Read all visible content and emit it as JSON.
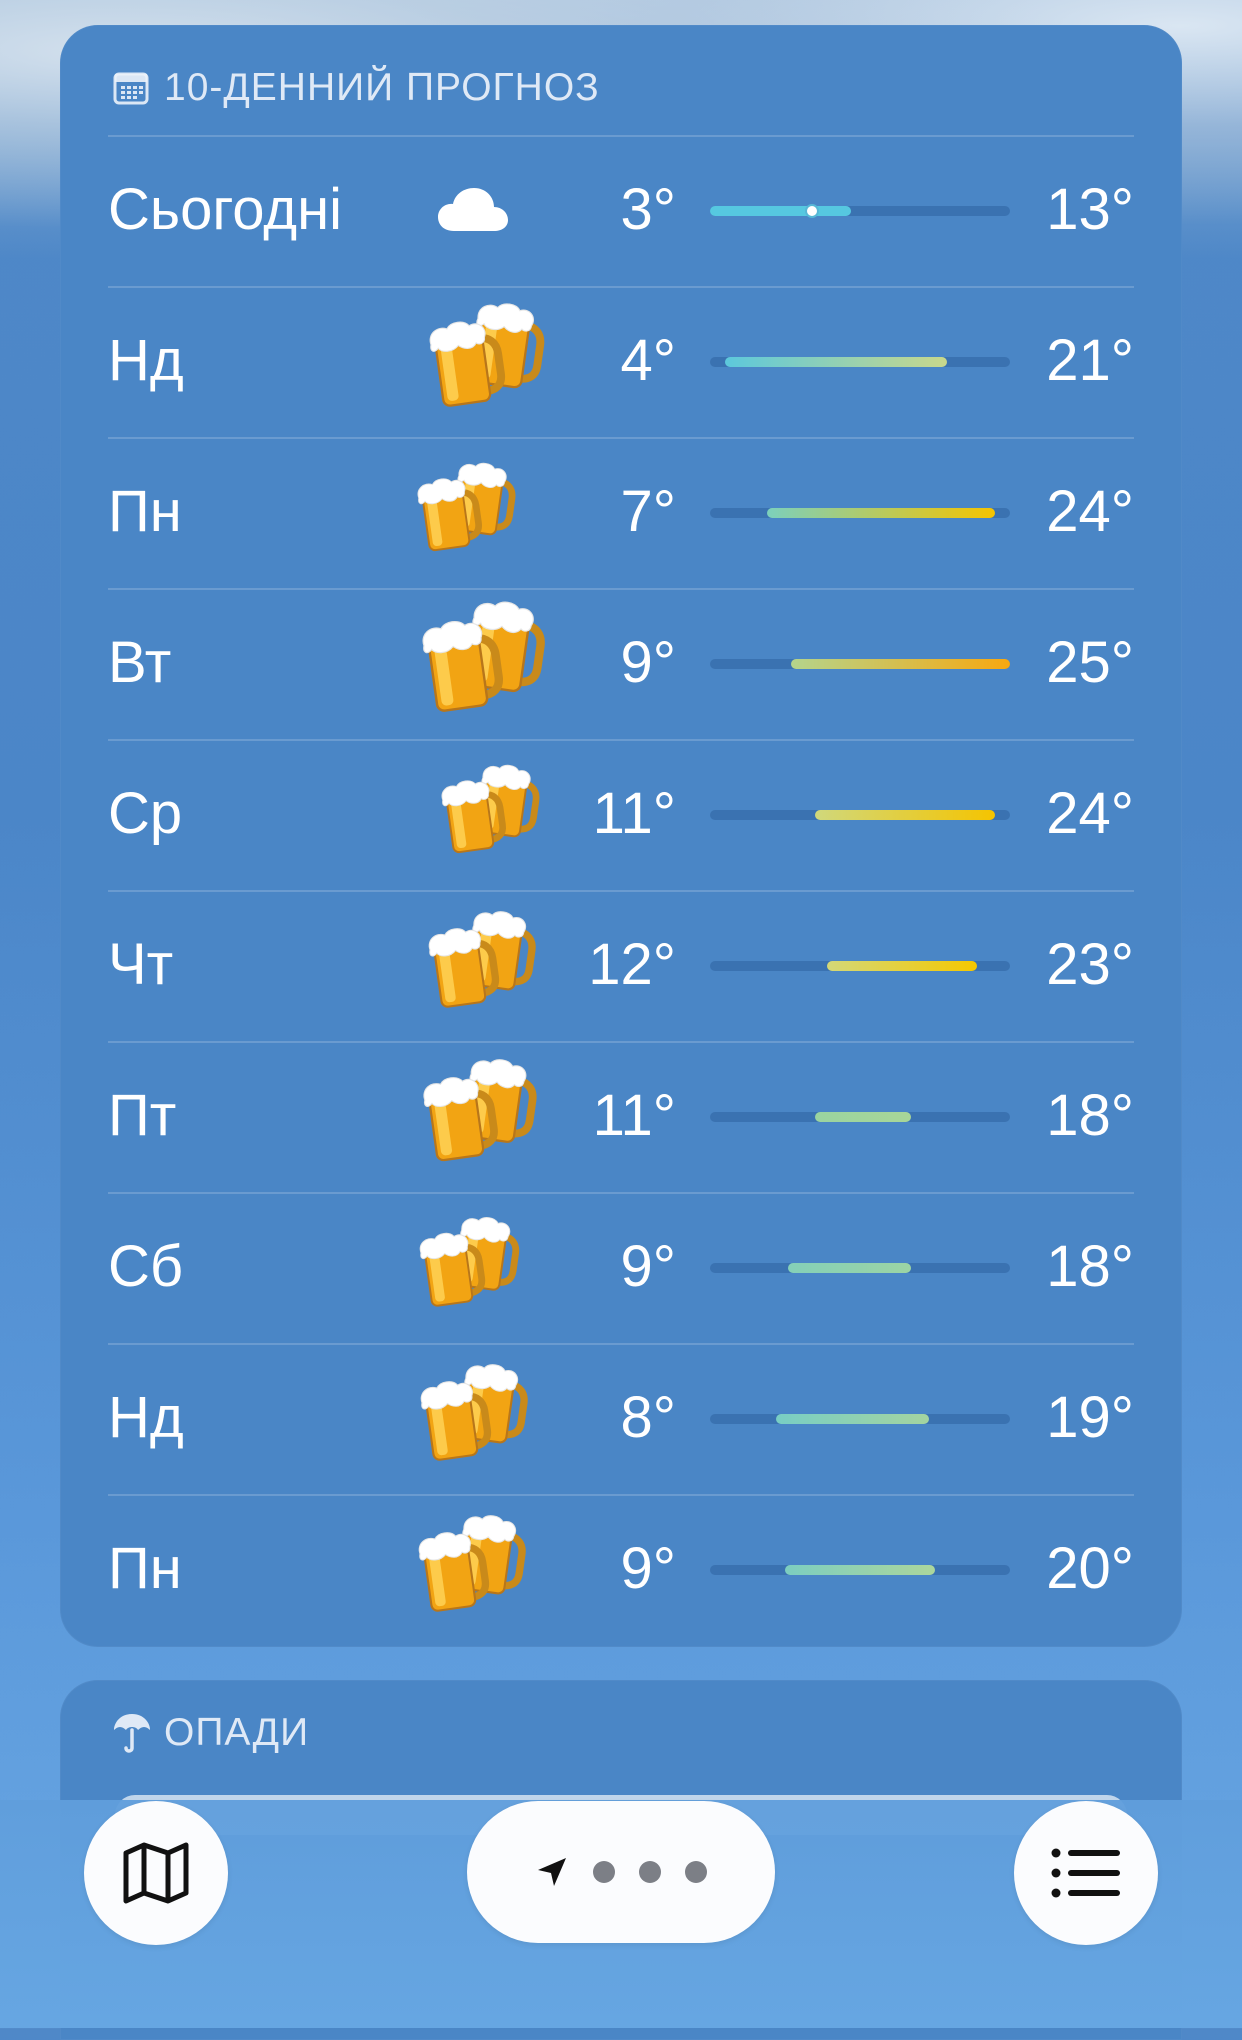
{
  "forecast": {
    "title": "10-ДЕННИЙ ПРОГНОЗ",
    "header_icon": "calendar-icon",
    "days": [
      {
        "day": "Сьогодні",
        "icon": "cloud-icon",
        "low": "3°",
        "high": "13°",
        "bar_start": 0.0,
        "bar_end": 0.47,
        "current_marker": 0.34,
        "colors": [
          "#56c8e0",
          "#56c8e0"
        ]
      },
      {
        "day": "Нд",
        "icon": "beer-mugs-icon",
        "low": "4°",
        "high": "21°",
        "bar_start": 0.05,
        "bar_end": 0.79,
        "colors": [
          "#5cc8dc",
          "#c8d88c"
        ]
      },
      {
        "day": "Пн",
        "icon": "beer-mugs-icon",
        "low": "7°",
        "high": "24°",
        "bar_start": 0.19,
        "bar_end": 0.95,
        "colors": [
          "#7cd0bc",
          "#f5c400"
        ]
      },
      {
        "day": "Вт",
        "icon": "beer-mugs-icon",
        "low": "9°",
        "high": "25°",
        "bar_start": 0.27,
        "bar_end": 1.0,
        "colors": [
          "#b4d48c",
          "#f8a810"
        ]
      },
      {
        "day": "Ср",
        "icon": "beer-mugs-icon",
        "low": "11°",
        "high": "24°",
        "bar_start": 0.35,
        "bar_end": 0.95,
        "colors": [
          "#d0d87c",
          "#f5c400"
        ]
      },
      {
        "day": "Чт",
        "icon": "beer-mugs-icon",
        "low": "12°",
        "high": "23°",
        "bar_start": 0.39,
        "bar_end": 0.89,
        "colors": [
          "#d4d878",
          "#f5c800"
        ]
      },
      {
        "day": "Пт",
        "icon": "beer-mugs-icon",
        "low": "11°",
        "high": "18°",
        "bar_start": 0.35,
        "bar_end": 0.67,
        "colors": [
          "#9ad4a0",
          "#a8d698"
        ]
      },
      {
        "day": "Сб",
        "icon": "beer-mugs-icon",
        "low": "9°",
        "high": "18°",
        "bar_start": 0.26,
        "bar_end": 0.67,
        "colors": [
          "#84d0b8",
          "#9cd4a4"
        ]
      },
      {
        "day": "Нд",
        "icon": "beer-mugs-icon",
        "low": "8°",
        "high": "19°",
        "bar_start": 0.22,
        "bar_end": 0.73,
        "colors": [
          "#78cec4",
          "#a4d4a0"
        ]
      },
      {
        "day": "Пн",
        "icon": "beer-mugs-icon",
        "low": "9°",
        "high": "20°",
        "bar_start": 0.25,
        "bar_end": 0.75,
        "colors": [
          "#7ccec0",
          "#acd69c"
        ]
      }
    ]
  },
  "precipitation": {
    "title": "ОПАДИ",
    "icon": "umbrella-icon"
  },
  "toolbar": {
    "map_icon": "map-icon",
    "location_icon": "location-arrow-icon",
    "list_icon": "list-icon",
    "page_count": 3
  }
}
